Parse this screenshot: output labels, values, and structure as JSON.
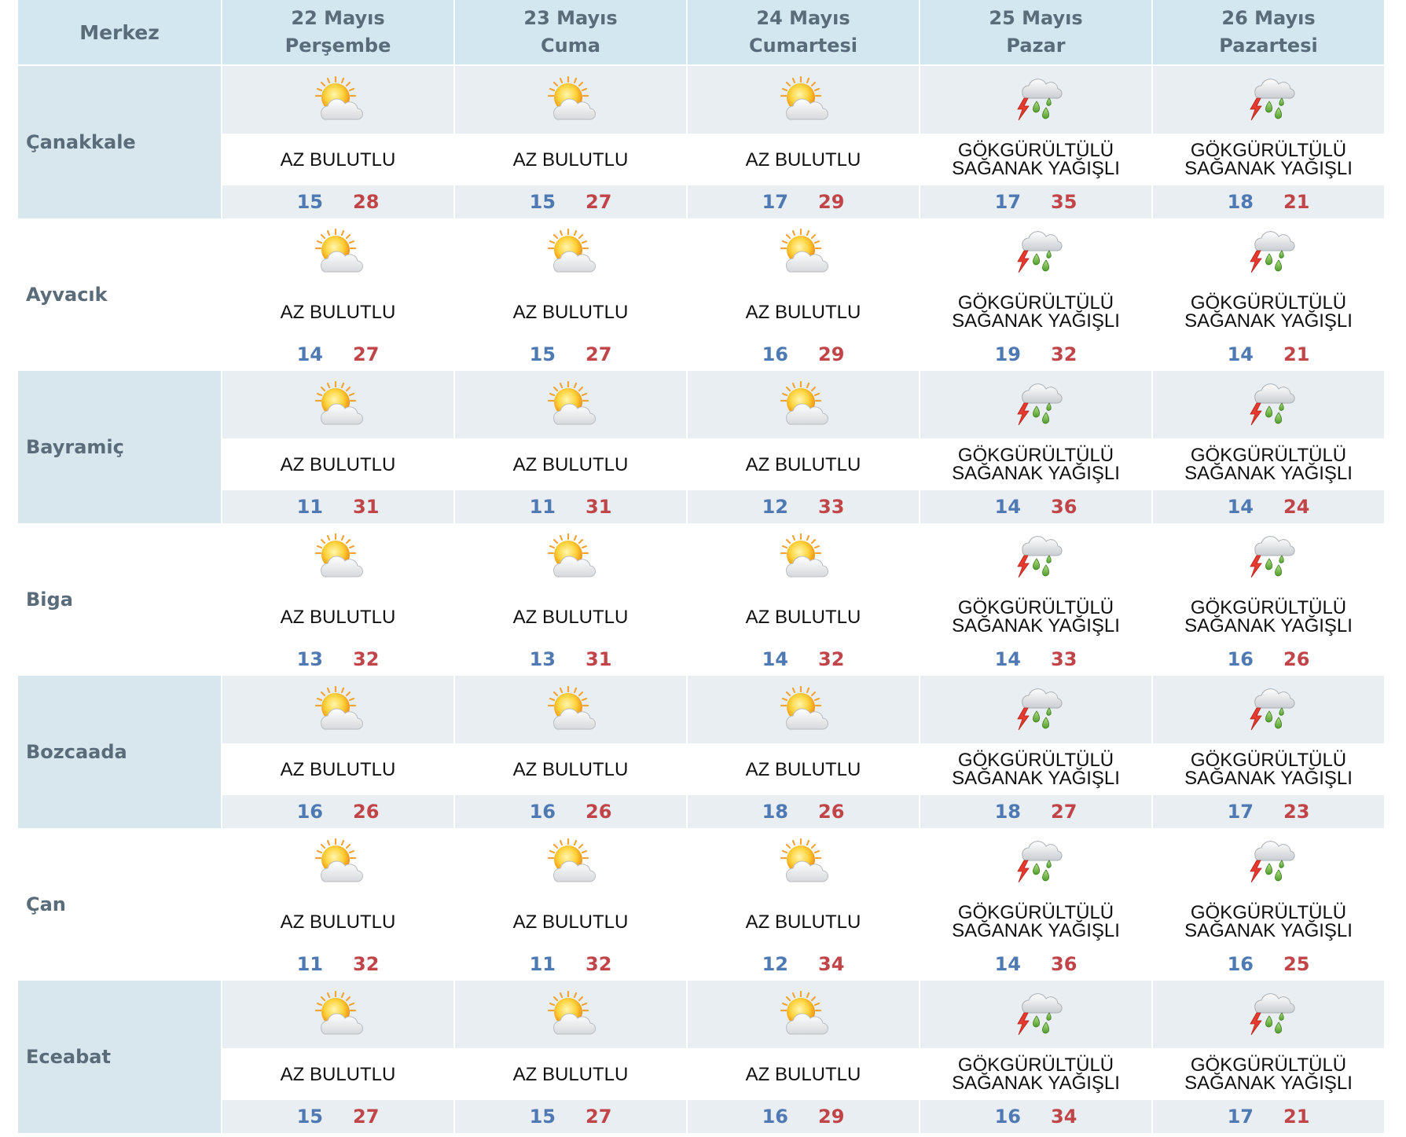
{
  "header": {
    "station_label": "Merkez",
    "days": [
      {
        "date": "22 Mayıs",
        "weekday": "Perşembe"
      },
      {
        "date": "23 Mayıs",
        "weekday": "Cuma"
      },
      {
        "date": "24 Mayıs",
        "weekday": "Cumartesi"
      },
      {
        "date": "25 Mayıs",
        "weekday": "Pazar"
      },
      {
        "date": "26 Mayıs",
        "weekday": "Pazartesi"
      }
    ]
  },
  "conditions": {
    "partly_cloudy": {
      "line1": "AZ BULUTLU",
      "line2": "",
      "icon": "partly-cloudy-icon"
    },
    "thunder": {
      "line1": "GÖKGÜRÜLTÜLÜ",
      "line2": "SAĞANAK YAĞIŞLI",
      "icon": "thunder-shower-icon"
    }
  },
  "colors": {
    "min_temp": "#4e79b3",
    "max_temp": "#c04448",
    "header_bg": "#d3e7f0",
    "alt_row_bg": "#e9eef2"
  },
  "rows": [
    {
      "name": "Çanakkale",
      "alt": true,
      "days": [
        {
          "cond": "partly_cloudy",
          "min": "15",
          "max": "28"
        },
        {
          "cond": "partly_cloudy",
          "min": "15",
          "max": "27"
        },
        {
          "cond": "partly_cloudy",
          "min": "17",
          "max": "29"
        },
        {
          "cond": "thunder",
          "min": "17",
          "max": "35"
        },
        {
          "cond": "thunder",
          "min": "18",
          "max": "21"
        }
      ]
    },
    {
      "name": "Ayvacık",
      "alt": false,
      "days": [
        {
          "cond": "partly_cloudy",
          "min": "14",
          "max": "27"
        },
        {
          "cond": "partly_cloudy",
          "min": "15",
          "max": "27"
        },
        {
          "cond": "partly_cloudy",
          "min": "16",
          "max": "29"
        },
        {
          "cond": "thunder",
          "min": "19",
          "max": "32"
        },
        {
          "cond": "thunder",
          "min": "14",
          "max": "21"
        }
      ]
    },
    {
      "name": "Bayramiç",
      "alt": true,
      "days": [
        {
          "cond": "partly_cloudy",
          "min": "11",
          "max": "31"
        },
        {
          "cond": "partly_cloudy",
          "min": "11",
          "max": "31"
        },
        {
          "cond": "partly_cloudy",
          "min": "12",
          "max": "33"
        },
        {
          "cond": "thunder",
          "min": "14",
          "max": "36"
        },
        {
          "cond": "thunder",
          "min": "14",
          "max": "24"
        }
      ]
    },
    {
      "name": "Biga",
      "alt": false,
      "days": [
        {
          "cond": "partly_cloudy",
          "min": "13",
          "max": "32"
        },
        {
          "cond": "partly_cloudy",
          "min": "13",
          "max": "31"
        },
        {
          "cond": "partly_cloudy",
          "min": "14",
          "max": "32"
        },
        {
          "cond": "thunder",
          "min": "14",
          "max": "33"
        },
        {
          "cond": "thunder",
          "min": "16",
          "max": "26"
        }
      ]
    },
    {
      "name": "Bozcaada",
      "alt": true,
      "days": [
        {
          "cond": "partly_cloudy",
          "min": "16",
          "max": "26"
        },
        {
          "cond": "partly_cloudy",
          "min": "16",
          "max": "26"
        },
        {
          "cond": "partly_cloudy",
          "min": "18",
          "max": "26"
        },
        {
          "cond": "thunder",
          "min": "18",
          "max": "27"
        },
        {
          "cond": "thunder",
          "min": "17",
          "max": "23"
        }
      ]
    },
    {
      "name": "Çan",
      "alt": false,
      "days": [
        {
          "cond": "partly_cloudy",
          "min": "11",
          "max": "32"
        },
        {
          "cond": "partly_cloudy",
          "min": "11",
          "max": "32"
        },
        {
          "cond": "partly_cloudy",
          "min": "12",
          "max": "34"
        },
        {
          "cond": "thunder",
          "min": "14",
          "max": "36"
        },
        {
          "cond": "thunder",
          "min": "16",
          "max": "25"
        }
      ]
    },
    {
      "name": "Eceabat",
      "alt": true,
      "days": [
        {
          "cond": "partly_cloudy",
          "min": "15",
          "max": "27"
        },
        {
          "cond": "partly_cloudy",
          "min": "15",
          "max": "27"
        },
        {
          "cond": "partly_cloudy",
          "min": "16",
          "max": "29"
        },
        {
          "cond": "thunder",
          "min": "16",
          "max": "34"
        },
        {
          "cond": "thunder",
          "min": "17",
          "max": "21"
        }
      ]
    }
  ]
}
